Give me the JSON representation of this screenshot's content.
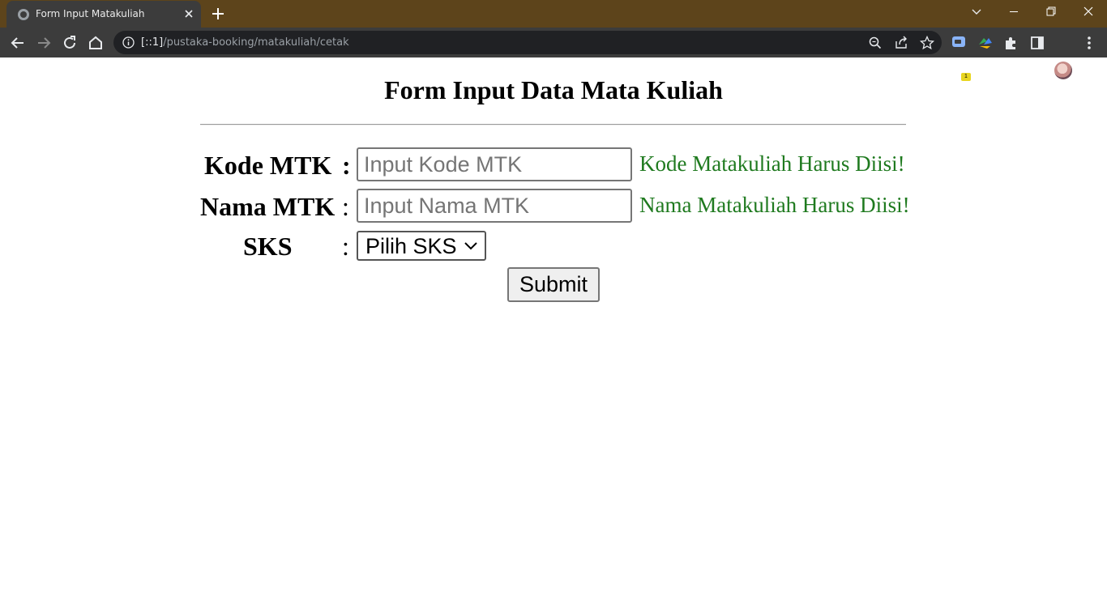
{
  "browser": {
    "tab_title": "Form Input Matakuliah",
    "url_host": "[::1]",
    "url_path": "/pustaka-booking/matakuliah/cetak",
    "extension_badge": "1",
    "colors": {
      "frame": "#5d441b",
      "toolbar": "#3c3c3c",
      "omnibox": "#202124"
    }
  },
  "form": {
    "title": "Form Input Data Mata Kuliah",
    "fields": {
      "kode": {
        "label": "Kode MTK",
        "separator": ":",
        "placeholder": "Input Kode MTK",
        "value": "",
        "error": "Kode Matakuliah Harus Diisi!"
      },
      "nama": {
        "label": "Nama MTK",
        "separator": ":",
        "placeholder": "Input Nama MTK",
        "value": "",
        "error": "Nama Matakuliah Harus Diisi!"
      },
      "sks": {
        "label": "SKS",
        "separator": ":",
        "selected": "Pilih SKS"
      }
    },
    "submit_label": "Submit",
    "colors": {
      "error_text": "#1f7a1f"
    }
  }
}
